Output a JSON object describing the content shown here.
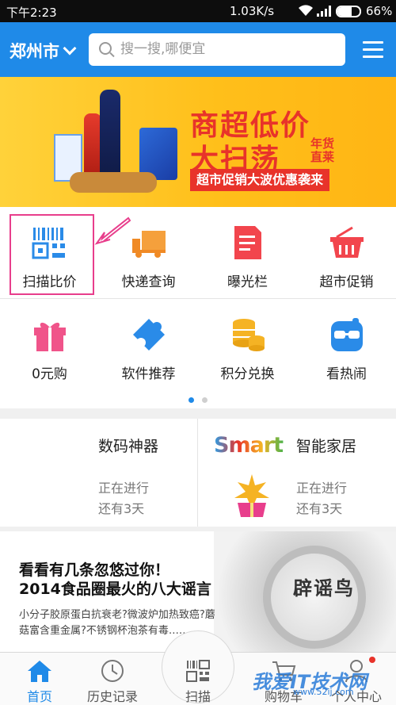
{
  "status_bar": {
    "time": "下午2:23",
    "speed": "1.03K/s",
    "battery_level": 0.66,
    "battery_pct": "66%"
  },
  "header": {
    "city": "郑州市",
    "search_placeholder": "搜一搜,哪便宜",
    "menu_icon": "hamburger-menu-icon"
  },
  "banner": {
    "headline_line1": "商超低价",
    "headline_line2": "大扫荡",
    "tag": "年货直莱",
    "promo": "超市促销大波优惠袭来"
  },
  "features": {
    "row1": [
      {
        "label": "扫描比价",
        "icon": "barcode-scan-icon"
      },
      {
        "label": "快递查询",
        "icon": "delivery-truck-icon"
      },
      {
        "label": "曝光栏",
        "icon": "document-icon"
      },
      {
        "label": "超市促销",
        "icon": "shopping-basket-icon"
      }
    ],
    "row2": [
      {
        "label": "0元购",
        "icon": "gift-box-icon"
      },
      {
        "label": "软件推荐",
        "icon": "puzzle-piece-icon"
      },
      {
        "label": "积分兑换",
        "icon": "coin-stack-icon"
      },
      {
        "label": "看热闹",
        "icon": "glasses-face-icon"
      }
    ],
    "page_count": 2,
    "active_page": 1
  },
  "events": [
    {
      "title": "数码神器",
      "status": "正在进行",
      "remaining": "还有3天"
    },
    {
      "title": "智能家居",
      "status": "正在进行",
      "remaining": "还有3天",
      "logo_text": "Smart"
    }
  ],
  "article": {
    "headline_line1": "看看有几条忽悠过你！",
    "headline_line2": "2014食品圈最火的八大谣言",
    "summary": "小分子胶原蛋白抗衰老?微波炉加热致癌?蘑菇富含重金属?不锈钢杯泡茶有毒……",
    "image_text": "辟谣鸟"
  },
  "tab_bar": {
    "tabs": [
      {
        "label": "首页",
        "icon": "home-icon",
        "active": true
      },
      {
        "label": "历史记录",
        "icon": "clock-icon",
        "active": false
      },
      {
        "label": "扫描",
        "icon": "qr-scan-icon",
        "active": false
      },
      {
        "label": "购物车",
        "icon": "cart-icon",
        "active": false
      },
      {
        "label": "个人中心",
        "icon": "user-icon",
        "active": false
      }
    ]
  },
  "watermark": {
    "text": "我爱IT技术网",
    "url": "www.52ij.com"
  },
  "colors": {
    "primary": "#1f8ae8",
    "banner_red": "#e8332a",
    "highlight": "#e83e8c"
  }
}
